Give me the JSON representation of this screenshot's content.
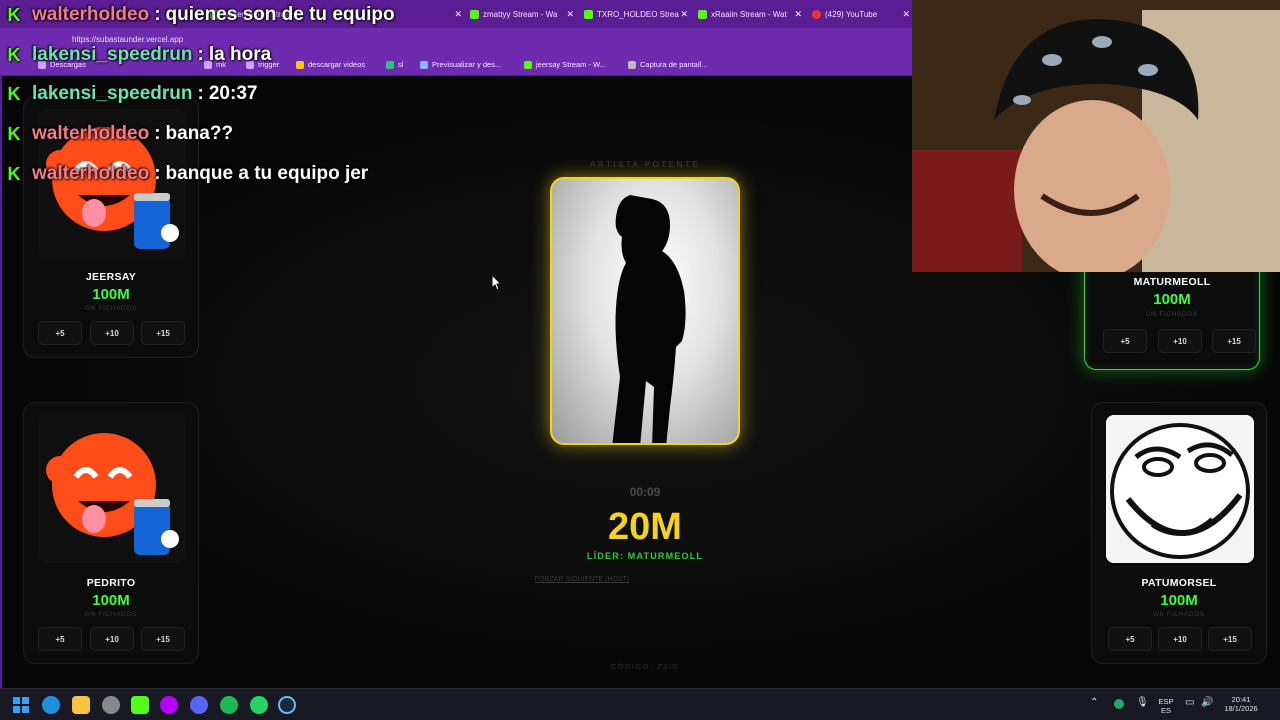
{
  "browser": {
    "tabs": [
      {
        "label": "walterholdeo Stream",
        "close": "✕"
      },
      {
        "label": "zmattyy Stream - Wa",
        "close": "✕"
      },
      {
        "label": "TXRO_HOLDEO Strea",
        "close": "✕"
      },
      {
        "label": "xRaaiin Stream - Wat",
        "close": "✕"
      },
      {
        "label": "(429) YouTube",
        "close": "✕"
      }
    ],
    "url": "https://subastaunder.vercel.app",
    "bookmarks": [
      "Descargas",
      "mk",
      "trigger",
      "descargar videos",
      "sl",
      "Previsualizar y des...",
      "jeersay Stream - W...",
      "Captura de pantall..."
    ]
  },
  "auction": {
    "section_label": "ARTISTA POTENTE",
    "timer": "00:09",
    "current_price": "20M",
    "leader_text": "LÍDER: MATURMEOLL",
    "force_next": "FORZAR SIGUIENTE (HOST)",
    "code": "CÓDIGO: Z0ID"
  },
  "teams": [
    {
      "name": "JEERSAY",
      "money": "100M",
      "sub": "0/6 FICHADOS",
      "avatar": "orange-mascot"
    },
    {
      "name": "MATURMEOLL",
      "money": "100M",
      "sub": "0/6 FICHADOS",
      "avatar": "hidden-by-webcam"
    },
    {
      "name": "PEDRITO",
      "money": "100M",
      "sub": "0/6 FICHADOS",
      "avatar": "orange-mascot"
    },
    {
      "name": "PATUMORSEL",
      "money": "100M",
      "sub": "0/6 FICHADOS",
      "avatar": "troll-face"
    }
  ],
  "bid_buttons": [
    "+5",
    "+10",
    "+15"
  ],
  "chat": [
    {
      "user": "walterholdeo",
      "color": "#f07c8c",
      "message": "quienes son de tu equipo"
    },
    {
      "user": "lakensi_speedrun",
      "color": "#6fe0b0",
      "message": "la hora"
    },
    {
      "user": "lakensi_speedrun",
      "color": "#6fe0b0",
      "message": "20:37"
    },
    {
      "user": "walterholdeo",
      "color": "#f07c8c",
      "message": "bana??"
    },
    {
      "user": "walterholdeo",
      "color": "#f07c8c",
      "message": "banque a tu equipo jer"
    }
  ],
  "taskbar": {
    "lang": "ESP",
    "region": "ES",
    "time": "20:41",
    "date": "18/1/2026"
  },
  "colors": {
    "accent_yellow": "#f5d31b",
    "accent_green": "#22e334",
    "browser_purple": "#6f2bb0",
    "kick_green": "#53fc18"
  }
}
